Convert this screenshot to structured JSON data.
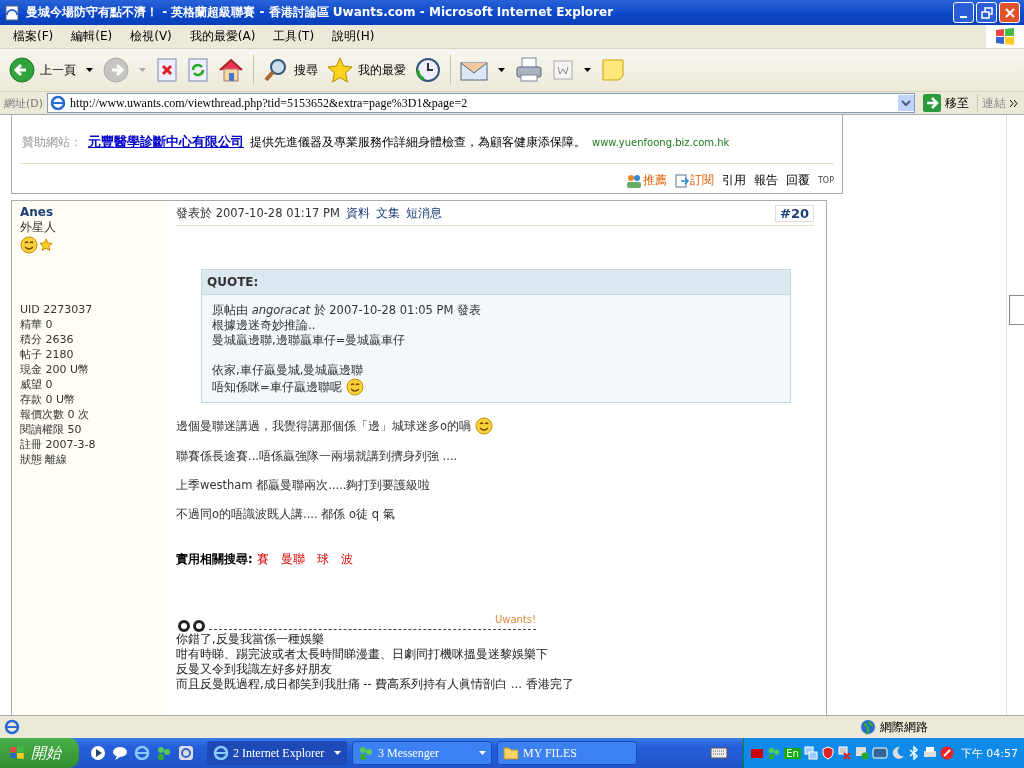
{
  "window": {
    "title": "曼城今場防守有點不濟！ - 英格蘭超級聯賽 - 香港討論區 Uwants.com - Microsoft Internet Explorer"
  },
  "menu": [
    "檔案(F)",
    "編輯(E)",
    "檢視(V)",
    "我的最愛(A)",
    "工具(T)",
    "說明(H)"
  ],
  "toolbar": [
    {
      "kind": "back",
      "label": "上一頁",
      "dropdown": true,
      "disabled": false
    },
    {
      "kind": "forward",
      "dropdown": true,
      "disabled": true
    },
    {
      "kind": "stop",
      "disabled": false
    },
    {
      "kind": "refresh",
      "disabled": false
    },
    {
      "kind": "home",
      "disabled": false
    },
    {
      "kind": "search",
      "label": "搜尋",
      "disabled": false
    },
    {
      "kind": "favorites",
      "label": "我的最愛",
      "disabled": false
    },
    {
      "kind": "history",
      "disabled": false
    },
    {
      "kind": "mail",
      "dropdown": true,
      "disabled": false
    },
    {
      "kind": "print",
      "disabled": false
    },
    {
      "kind": "edit",
      "dropdown": true,
      "disabled": false
    },
    {
      "kind": "note",
      "disabled": false
    }
  ],
  "address": {
    "label": "網址(D)",
    "url": "http://www.uwants.com/viewthread.php?tid=5153652&extra=page%3D1&page=2",
    "go": "移至",
    "links": "連結"
  },
  "sponsor": {
    "label": "贊助網站：",
    "link": "元豐醫學診斷中心有限公司",
    "text": "提供先進儀器及專業服務作詳細身體檢查，為顧客健康添保障。",
    "site": "www.yuenfoong.biz.com.hk"
  },
  "post_actions": [
    {
      "kind": "recommend",
      "label": "推薦"
    },
    {
      "kind": "subscribe",
      "label": "訂閱"
    },
    {
      "kind": "plain",
      "label": "引用"
    },
    {
      "kind": "plain",
      "label": "報告"
    },
    {
      "kind": "plain",
      "label": "回覆"
    },
    {
      "kind": "top",
      "label": "TOP"
    }
  ],
  "post": {
    "author": "Anes",
    "rank": "外星人",
    "stats": [
      "UID 2273037",
      "精華 0",
      "積分 2636",
      "帖子 2180",
      "現金 200 U幣",
      "威望 0",
      "存款 0 U幣",
      "報價次數 0 次",
      "閱讀權限 50",
      "註冊 2007-3-8",
      "狀態 離線"
    ],
    "posted": "發表於 2007-10-28 01:17 PM",
    "links": [
      "資料",
      "文集",
      "短消息"
    ],
    "number": "#20",
    "quote": {
      "title": "QUOTE:",
      "lines": [
        {
          "text": "原帖由 *angoracat* 於 2007-10-28 01:05 PM 發表",
          "smiley": false
        },
        {
          "text": "根據邊迷奇妙推論..",
          "smiley": false
        },
        {
          "text": "曼城贏邊聯,邊聯贏車仔=曼城贏車仔",
          "smiley": false
        },
        {
          "kind": "blank"
        },
        {
          "text": "依家,車仔贏曼城,曼城贏邊聯",
          "smiley": false
        },
        {
          "text": "唔知係咪=車仔贏邊聯呢",
          "smiley": true
        }
      ]
    },
    "body": [
      {
        "text": "邊個曼聯迷講過，我覺得講那個係「邊」城球迷多o的喎",
        "smiley": true
      },
      {
        "text": "聯賽係長途賽...唔係贏強隊一兩場就講到擠身列強 ....",
        "smiley": false
      },
      {
        "text": "上季westham 都贏曼聯兩次.....夠打到要護級啦",
        "smiley": false
      },
      {
        "text": "不過同o的唔識波既人講.... 都係 o徒 q 氣",
        "smiley": false
      }
    ],
    "related": {
      "label": "實用相關搜尋:",
      "tags": [
        "賽",
        "曼聯",
        "球",
        "波"
      ]
    },
    "signature": {
      "brand": "Uwants!",
      "lines": [
        "你錯了,反曼我當係一種娛樂",
        "咁有時睇、踢完波或者太長時間睇漫畫、日劇同打機咪搵曼迷黎娛樂下",
        "反曼又令到我識左好多好朋友",
        "而且反曼既過程,成日都笑到我肚痛 -- 費高系列持有人眞情剖白 ... 香港完了"
      ]
    }
  },
  "status_bar": {
    "zone": "網際網路"
  },
  "taskbar": {
    "start": "開始",
    "tasks": [
      {
        "label": "2 Internet Explorer",
        "kind": "ie",
        "selected": true
      },
      {
        "label": "3 Messenger",
        "kind": "messenger",
        "selected": false
      },
      {
        "label": "MY FILES",
        "kind": "folder",
        "selected": false
      }
    ],
    "language": "En",
    "clock": "下午 04:57"
  }
}
